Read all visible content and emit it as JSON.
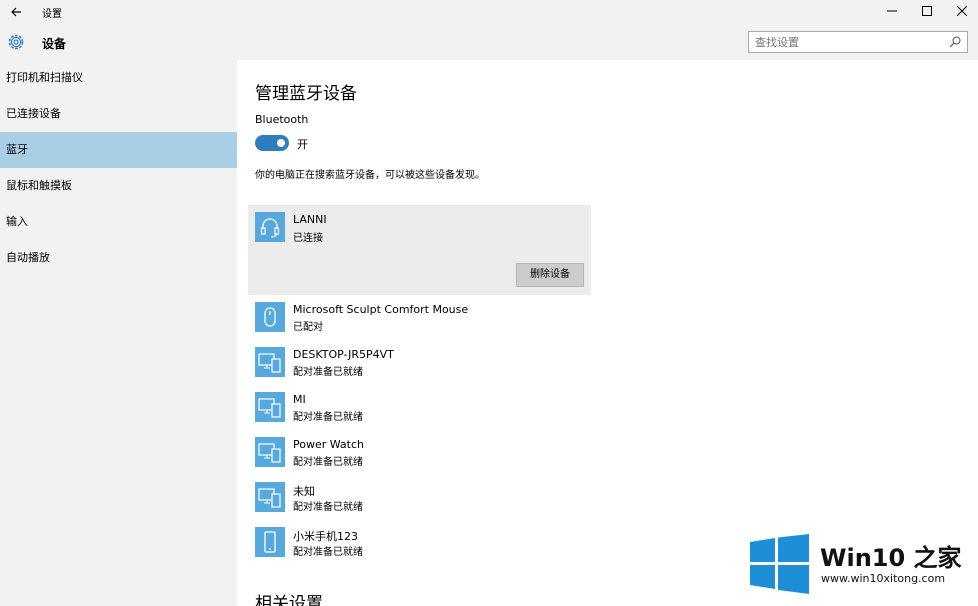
{
  "window": {
    "title": "设置",
    "back_icon": "arrow-left-icon",
    "minimize_icon": "minimize-icon",
    "maximize_icon": "maximize-icon",
    "close_icon": "close-icon"
  },
  "header": {
    "icon": "gear-icon",
    "title": "设备",
    "search": {
      "placeholder": "查找设置",
      "value": "",
      "icon": "search-icon"
    }
  },
  "sidebar": {
    "items": [
      {
        "label": "打印机和扫描仪",
        "active": false
      },
      {
        "label": "已连接设备",
        "active": false
      },
      {
        "label": "蓝牙",
        "active": true
      },
      {
        "label": "鼠标和触摸板",
        "active": false
      },
      {
        "label": "输入",
        "active": false
      },
      {
        "label": "自动播放",
        "active": false
      }
    ]
  },
  "main": {
    "title": "管理蓝牙设备",
    "bluetooth_label": "Bluetooth",
    "toggle_state": "开",
    "description": "你的电脑正在搜索蓝牙设备，可以被这些设备发现。",
    "selected_device": {
      "name": "LANNI",
      "status": "已连接",
      "icon": "headset-icon",
      "remove_label": "删除设备"
    },
    "devices": [
      {
        "name": "Microsoft Sculpt Comfort Mouse",
        "status": "已配对",
        "icon": "mouse-icon"
      },
      {
        "name": "DESKTOP-JR5P4VT",
        "status": "配对准备已就绪",
        "icon": "computer-phone-icon"
      },
      {
        "name": "MI",
        "status": "配对准备已就绪",
        "icon": "computer-phone-icon"
      },
      {
        "name": "Power Watch",
        "status": "配对准备已就绪",
        "icon": "computer-phone-icon"
      },
      {
        "name": "未知",
        "status": "配对准备已就绪",
        "icon": "computer-phone-icon"
      },
      {
        "name": "小米手机123",
        "status": "配对准备已就绪",
        "icon": "phone-icon"
      }
    ],
    "related_title": "相关设置"
  },
  "watermark": {
    "title": "Win10 之家",
    "url": "www.win10xitong.com",
    "logo_icon": "windows-logo-icon"
  },
  "colors": {
    "accent": "#2d7dbf",
    "device_icon_bg": "#56a8dd",
    "sidebar_active": "#a9cfe6",
    "sidebar_bg": "#f2f2f2",
    "logo_blue": "#1e8fd6"
  }
}
